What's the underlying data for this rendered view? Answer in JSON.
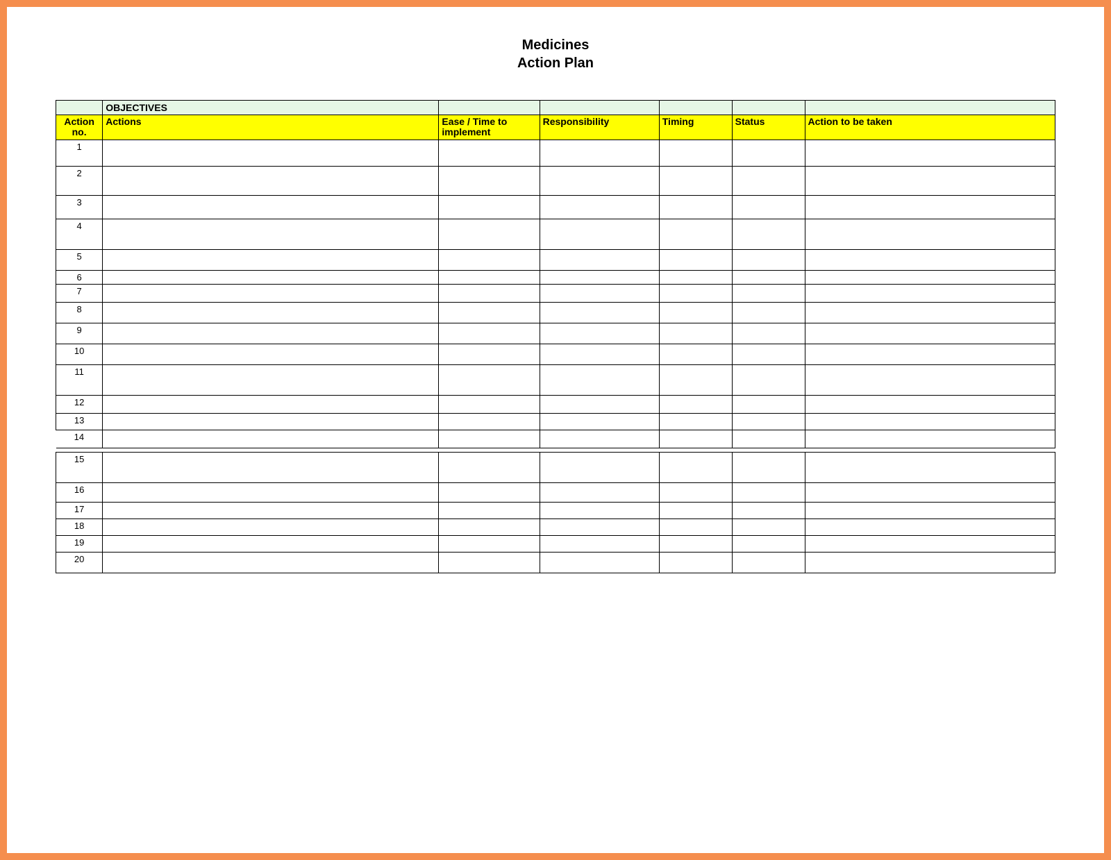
{
  "title": {
    "line1": "Medicines",
    "line2": "Action Plan"
  },
  "objectives_label": "OBJECTIVES",
  "headers": {
    "action_no": "Action no.",
    "actions": "Actions",
    "ease": "Ease / Time to implement",
    "responsibility": "Responsibility",
    "timing": "Timing",
    "status": "Status",
    "to_be_taken": "Action to be taken"
  },
  "rows": [
    {
      "no": "1",
      "actions": "",
      "ease": "",
      "responsibility": "",
      "timing": "",
      "status": "",
      "to_be_taken": ""
    },
    {
      "no": "2",
      "actions": "",
      "ease": "",
      "responsibility": "",
      "timing": "",
      "status": "",
      "to_be_taken": ""
    },
    {
      "no": "3",
      "actions": "",
      "ease": "",
      "responsibility": "",
      "timing": "",
      "status": "",
      "to_be_taken": ""
    },
    {
      "no": "4",
      "actions": "",
      "ease": "",
      "responsibility": "",
      "timing": "",
      "status": "",
      "to_be_taken": ""
    },
    {
      "no": "5",
      "actions": "",
      "ease": "",
      "responsibility": "",
      "timing": "",
      "status": "",
      "to_be_taken": ""
    },
    {
      "no": "6",
      "actions": "",
      "ease": "",
      "responsibility": "",
      "timing": "",
      "status": "",
      "to_be_taken": ""
    },
    {
      "no": "7",
      "actions": "",
      "ease": "",
      "responsibility": "",
      "timing": "",
      "status": "",
      "to_be_taken": ""
    },
    {
      "no": "8",
      "actions": "",
      "ease": "",
      "responsibility": "",
      "timing": "",
      "status": "",
      "to_be_taken": ""
    },
    {
      "no": "9",
      "actions": "",
      "ease": "",
      "responsibility": "",
      "timing": "",
      "status": "",
      "to_be_taken": ""
    },
    {
      "no": "10",
      "actions": "",
      "ease": "",
      "responsibility": "",
      "timing": "",
      "status": "",
      "to_be_taken": ""
    },
    {
      "no": "11",
      "actions": "",
      "ease": "",
      "responsibility": "",
      "timing": "",
      "status": "",
      "to_be_taken": ""
    },
    {
      "no": "12",
      "actions": "",
      "ease": "",
      "responsibility": "",
      "timing": "",
      "status": "",
      "to_be_taken": ""
    },
    {
      "no": "13",
      "actions": "",
      "ease": "",
      "responsibility": "",
      "timing": "",
      "status": "",
      "to_be_taken": ""
    },
    {
      "no": "14",
      "actions": "",
      "ease": "",
      "responsibility": "",
      "timing": "",
      "status": "",
      "to_be_taken": ""
    },
    {
      "no": "15",
      "actions": "",
      "ease": "",
      "responsibility": "",
      "timing": "",
      "status": "",
      "to_be_taken": ""
    },
    {
      "no": "16",
      "actions": "",
      "ease": "",
      "responsibility": "",
      "timing": "",
      "status": "",
      "to_be_taken": ""
    },
    {
      "no": "17",
      "actions": "",
      "ease": "",
      "responsibility": "",
      "timing": "",
      "status": "",
      "to_be_taken": ""
    },
    {
      "no": "18",
      "actions": "",
      "ease": "",
      "responsibility": "",
      "timing": "",
      "status": "",
      "to_be_taken": ""
    },
    {
      "no": "19",
      "actions": "",
      "ease": "",
      "responsibility": "",
      "timing": "",
      "status": "",
      "to_be_taken": ""
    },
    {
      "no": "20",
      "actions": "",
      "ease": "",
      "responsibility": "",
      "timing": "",
      "status": "",
      "to_be_taken": ""
    }
  ]
}
